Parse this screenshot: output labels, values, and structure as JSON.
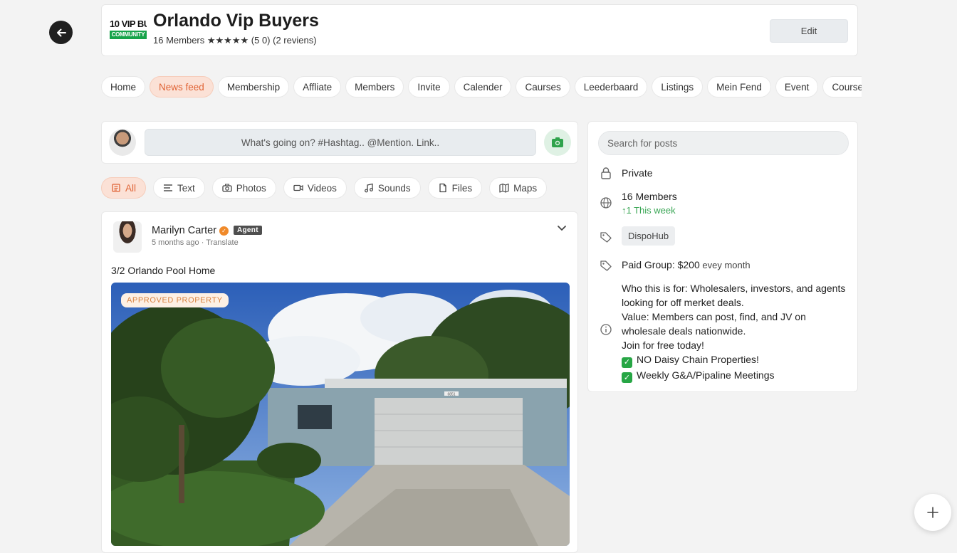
{
  "header": {
    "logo_line1_a": "10",
    "logo_line1_b": " VIP BU",
    "logo_line2": "COMMUNITY",
    "group_name": "Orlando Vip Buyers",
    "members_text": "16 Members",
    "stars": "★★★★★",
    "rating_text": "(5 0) (2 reviens)",
    "edit_label": "Edit"
  },
  "nav": {
    "tabs": [
      {
        "label": "Home",
        "active": false
      },
      {
        "label": "News feed",
        "active": true
      },
      {
        "label": "Membership",
        "active": false
      },
      {
        "label": "Affliate",
        "active": false
      },
      {
        "label": "Members",
        "active": false
      },
      {
        "label": "Invite",
        "active": false
      },
      {
        "label": "Calender",
        "active": false
      },
      {
        "label": "Caurses",
        "active": false
      },
      {
        "label": "Leederbaard",
        "active": false
      },
      {
        "label": "Listings",
        "active": false
      },
      {
        "label": "Mein Fend",
        "active": false
      },
      {
        "label": "Event",
        "active": false
      },
      {
        "label": "Course",
        "active": false
      }
    ]
  },
  "composer": {
    "placeholder": "What's going on? #Hashtag.. @Mention. Link.."
  },
  "filters": [
    {
      "label": "All",
      "icon": "all-icon",
      "active": true
    },
    {
      "label": "Text",
      "icon": "text-icon",
      "active": false
    },
    {
      "label": "Photos",
      "icon": "camera-icon",
      "active": false
    },
    {
      "label": "Videos",
      "icon": "video-icon",
      "active": false
    },
    {
      "label": "Sounds",
      "icon": "music-icon",
      "active": false
    },
    {
      "label": "Files",
      "icon": "file-icon",
      "active": false
    },
    {
      "label": "Maps",
      "icon": "map-icon",
      "active": false
    }
  ],
  "post": {
    "author": "Marilyn Carter",
    "role": "Agent",
    "time": "5 months ago",
    "translate": "Translate",
    "title": "3/2 Orlando Pool Home",
    "image_badge": "APPROVED PROPERTY",
    "house_number": "6851"
  },
  "sidebar": {
    "search_placeholder": "Search for posts",
    "privacy": "Private",
    "members": "16 Members",
    "members_week": "↑1 This week",
    "tag": "DispoHub",
    "paid_label": "Paid Group:",
    "paid_price": " $200",
    "paid_period": " evey month",
    "description_lines": [
      "Who this is for: Wholesalers, investors, and agents",
      "looking for off merket deals.",
      "Value: Members can post, find, and JV on",
      "wholesale deals nationwide.",
      "Join for free today!"
    ],
    "checks": [
      "NO Daisy Chain Properties!",
      "Weekly G&A/Pipaline Meetings"
    ]
  },
  "colors": {
    "accent": "#e06436",
    "accent_bg": "#fbe1d6",
    "green": "#3aa655"
  }
}
